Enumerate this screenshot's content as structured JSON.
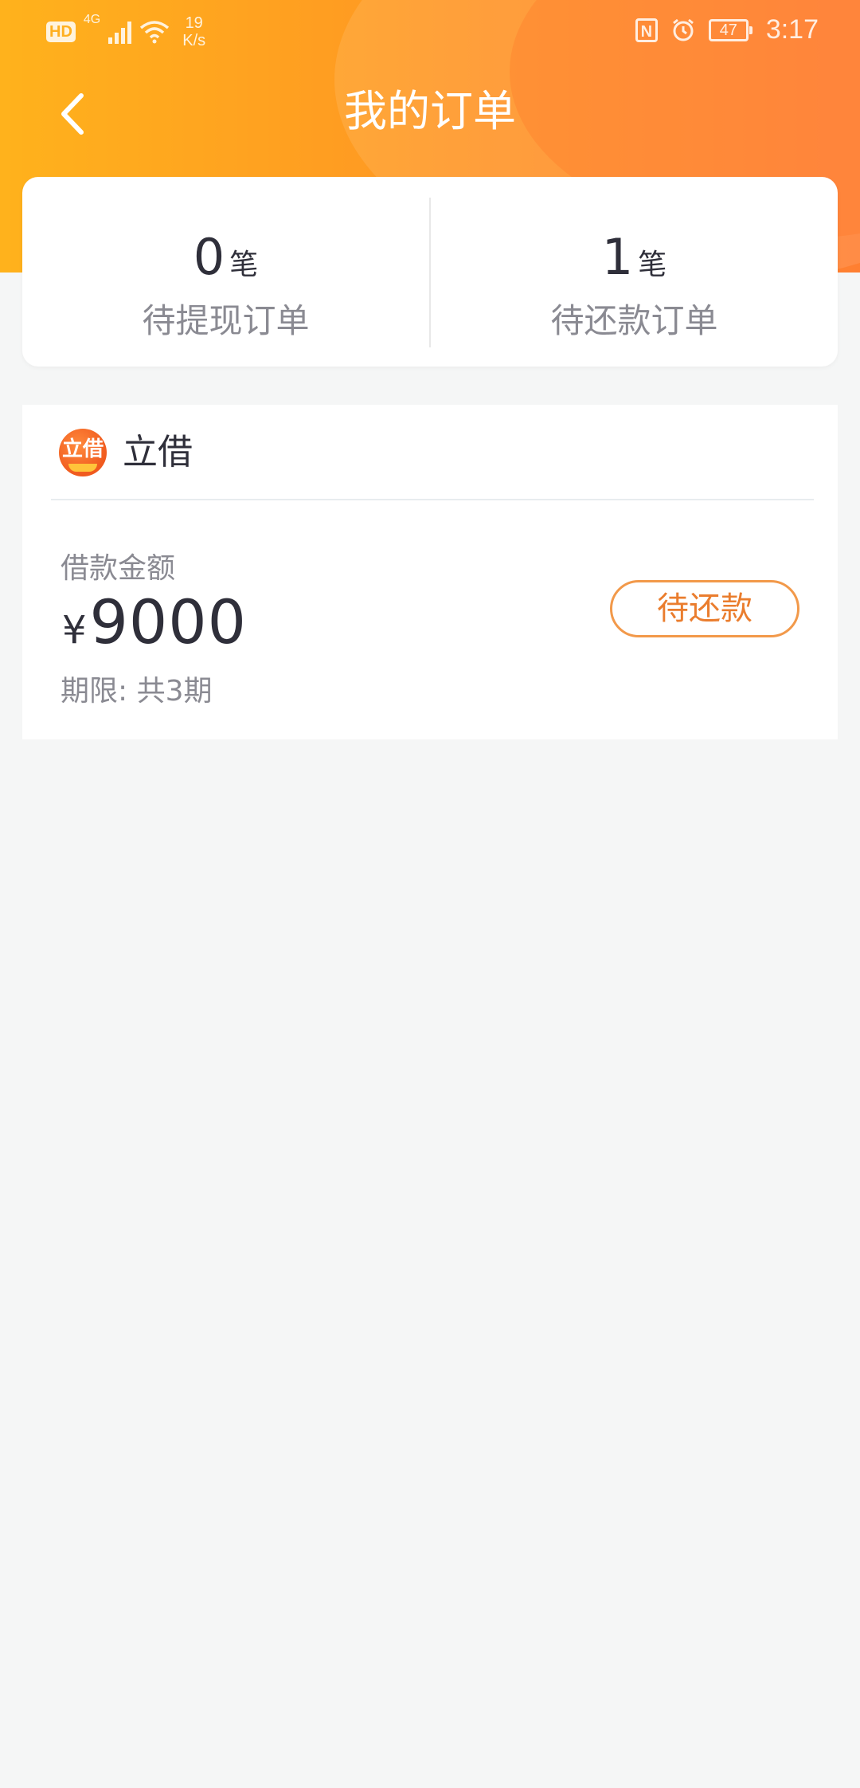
{
  "status_bar": {
    "hd": "HD",
    "network": "4G",
    "speed_value": "19",
    "speed_unit": "K/s",
    "nfc": "N",
    "battery": "47",
    "time": "3:17"
  },
  "nav": {
    "title": "我的订单"
  },
  "summary": {
    "pending_withdraw": {
      "count": "0",
      "unit": "笔",
      "label": "待提现订单"
    },
    "pending_repay": {
      "count": "1",
      "unit": "笔",
      "label": "待还款订单"
    }
  },
  "order": {
    "lender_logo_text": "立借",
    "lender_name": "立借",
    "amount_label": "借款金额",
    "currency": "¥",
    "amount": "9000",
    "term": "期限: 共3期",
    "status_button": "待还款"
  },
  "colors": {
    "header_orange_start": "#ffb21c",
    "header_orange_end": "#ff7f31",
    "accent_orange": "#ea7d2e",
    "page_bg": "#f5f6f6"
  }
}
